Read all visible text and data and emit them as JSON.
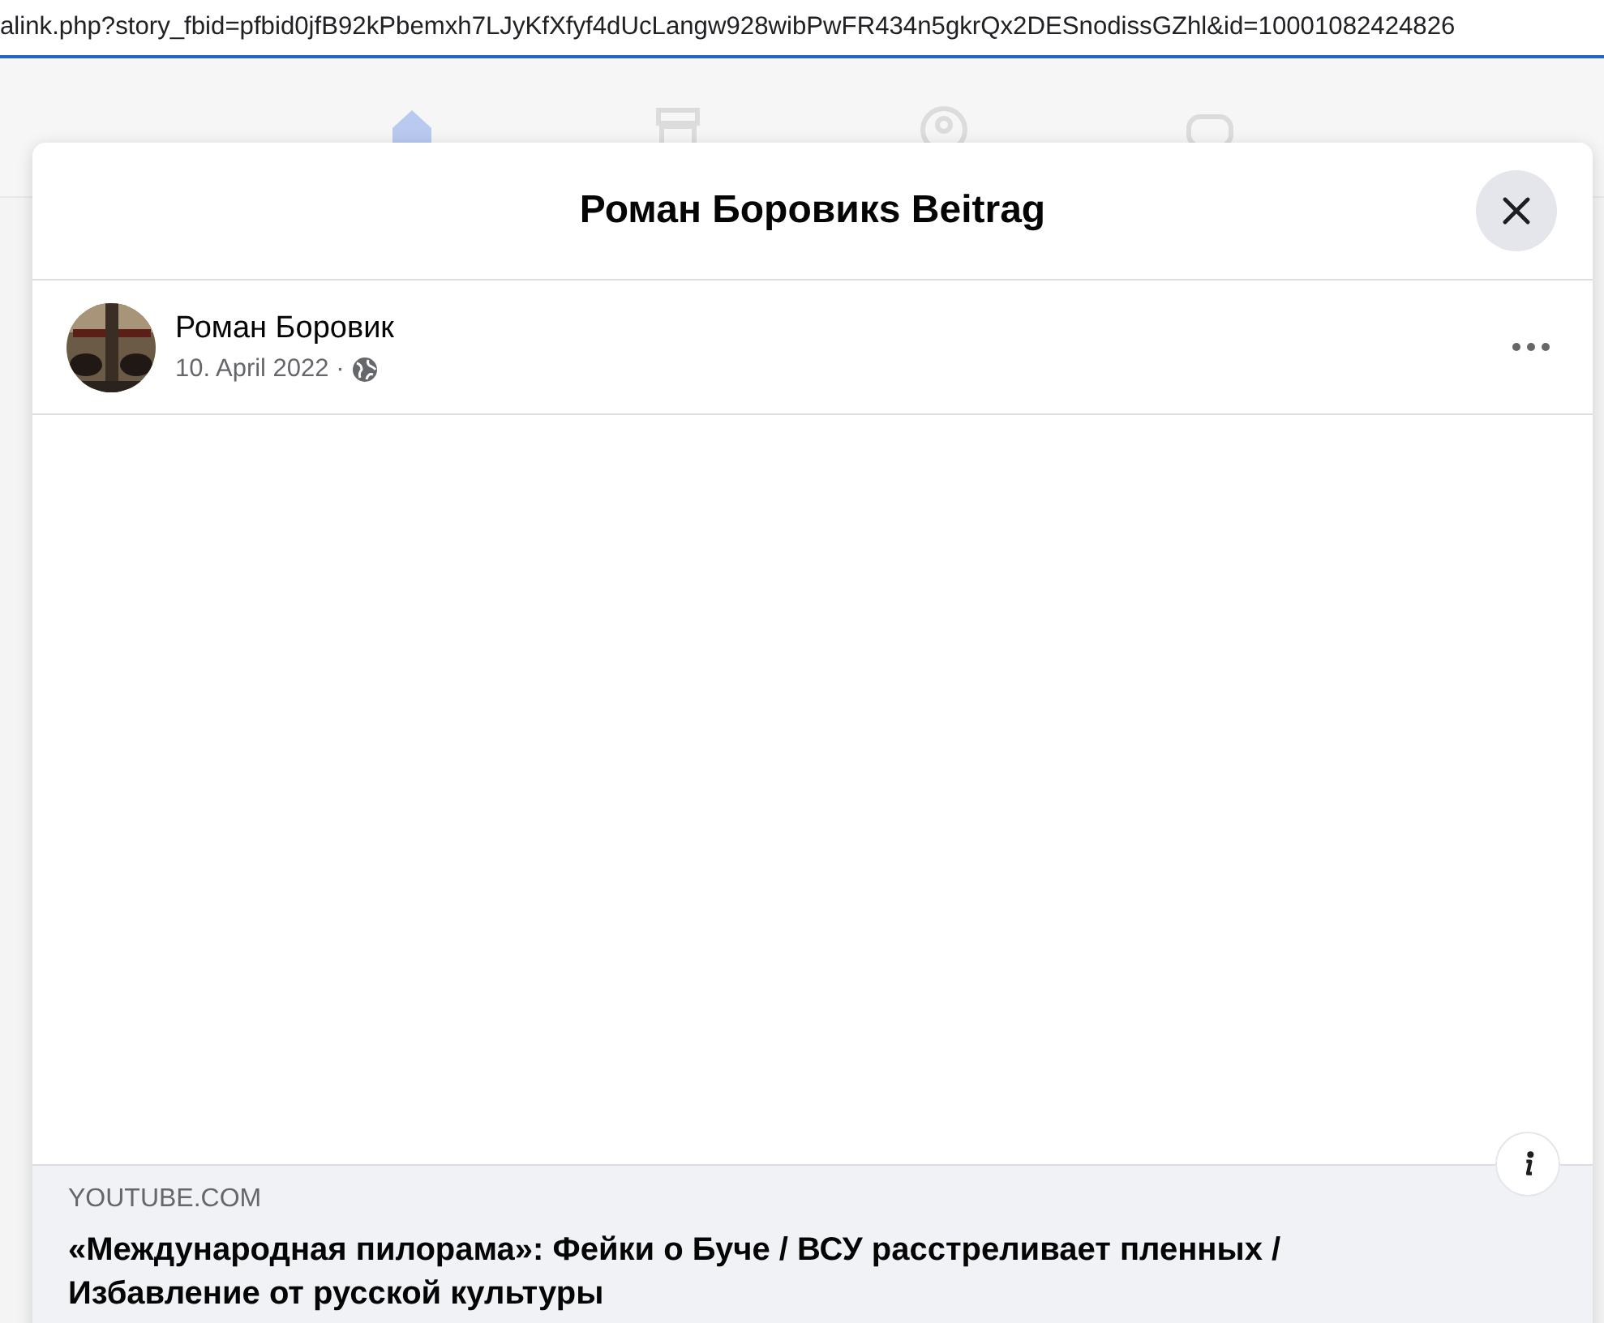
{
  "address_bar": {
    "url": "alink.php?story_fbid=pfbid0jfB92kPbemxh7LJyKfXfyf4dUcLangw928wibPwFR434n5gkrQx2DESnodissGZhl&id=10001082424826"
  },
  "nav": [
    {
      "kind": "home",
      "selected": true
    },
    {
      "kind": "store",
      "selected": false
    },
    {
      "kind": "groups",
      "selected": false
    },
    {
      "kind": "gaming",
      "selected": false
    }
  ],
  "dialog": {
    "title": "Роман Боровикs Beitrag",
    "post": {
      "author": "Роман Боровик",
      "date": "10. April 2022 ·",
      "public": true,
      "link_preview": {
        "domain": "YOUTUBE.COM",
        "title": "«Международная пилорама»: Фейки о Буче / ВСУ расстреливает пленных / Избавление от русской культуры"
      }
    }
  }
}
